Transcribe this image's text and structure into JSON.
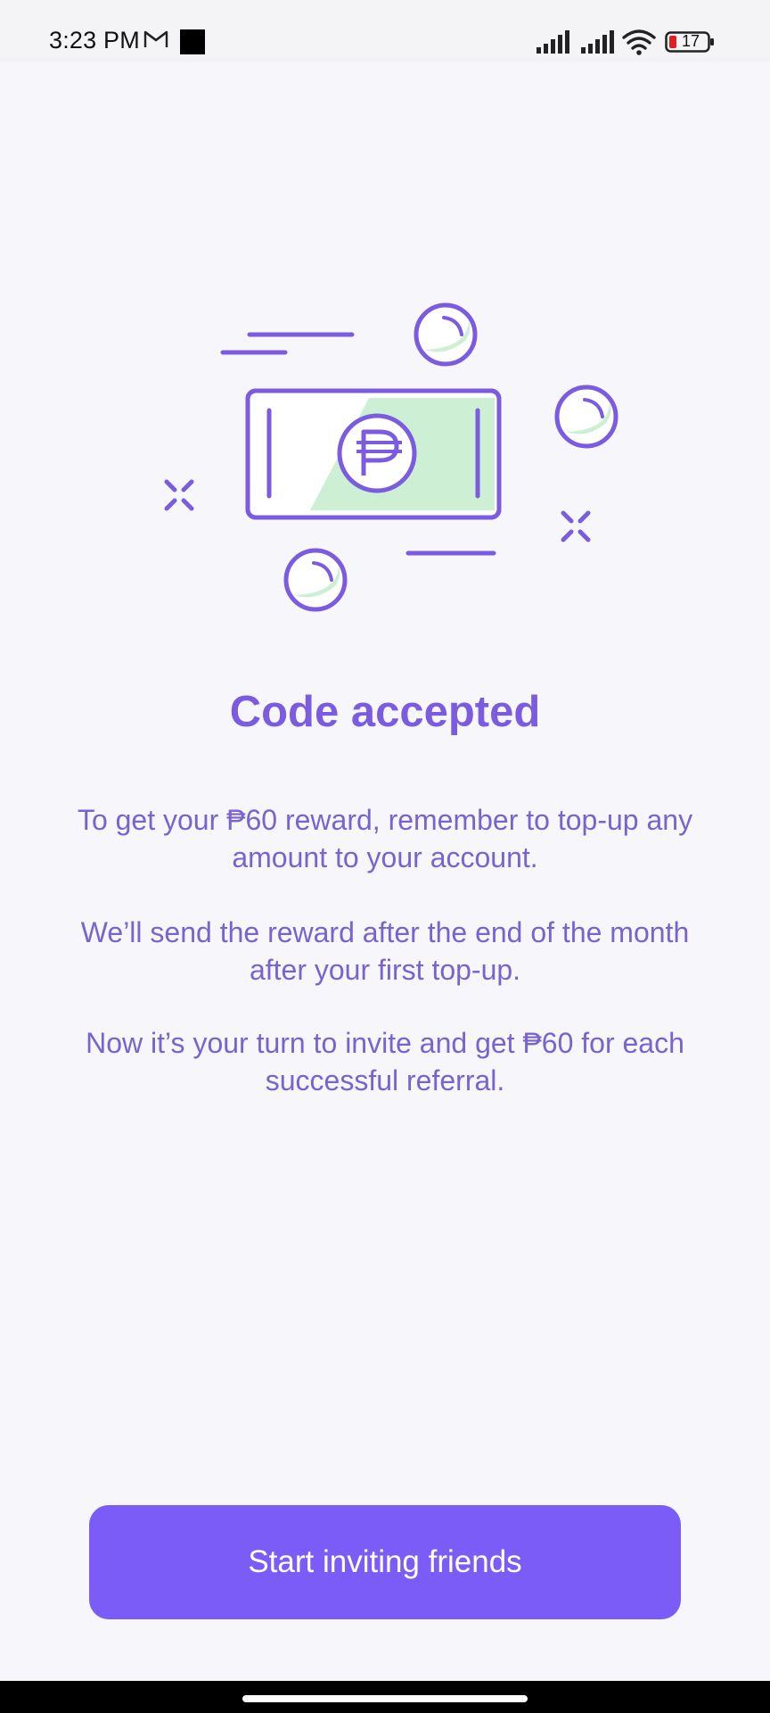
{
  "status_bar": {
    "time": "3:23 PM",
    "battery_level": "17",
    "icons": [
      "gmail-icon",
      "black-square-icon",
      "signal-icon",
      "signal-icon",
      "wifi-icon",
      "battery-icon"
    ]
  },
  "illustration": {
    "currency_symbol": "₱",
    "icon": "money-bill-with-coins-illustration",
    "colors": {
      "stroke": "#7B5CE0",
      "fill": "#CDEFD3"
    }
  },
  "content": {
    "title": "Code accepted",
    "paragraph_1": "To get your ₱60 reward, remember to top-up any amount to your account.",
    "paragraph_2": "We’ll send the reward after the end of the month after your first top-up.",
    "paragraph_3": "Now it’s your turn to invite and get ₱60 for each successful referral."
  },
  "actions": {
    "primary_label": "Start inviting friends"
  },
  "colors": {
    "accent": "#7B5CF6",
    "text": "#7A63CF",
    "background": "#F7F7FB"
  }
}
